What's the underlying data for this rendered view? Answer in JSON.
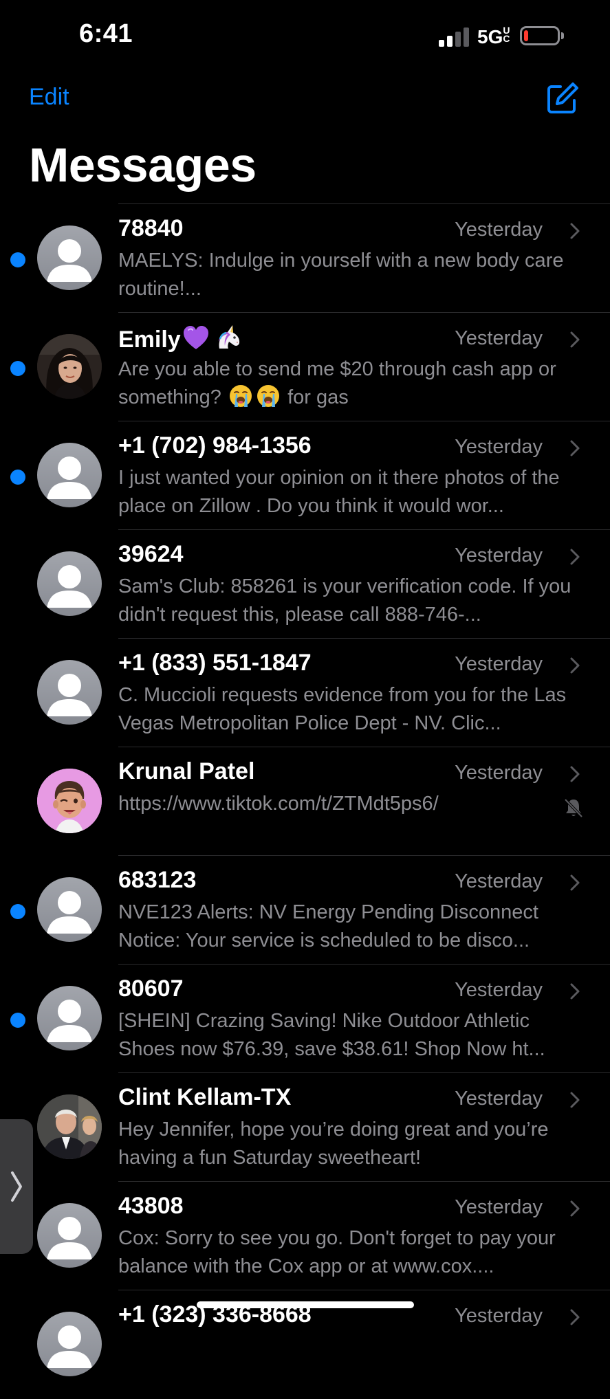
{
  "status_bar": {
    "time": "6:41",
    "network": "5G",
    "network_suffix": "UC",
    "battery_level": 0.1,
    "signal_bars_active": 2,
    "signal_bars_total": 4
  },
  "header": {
    "edit_label": "Edit",
    "compose_icon": "compose-icon",
    "title": "Messages"
  },
  "colors": {
    "accent": "#0a84ff",
    "background": "#000000",
    "secondary_text": "#8e8e93",
    "battery_low": "#ff3b30"
  },
  "conversations": [
    {
      "name": "78840",
      "time": "Yesterday",
      "preview": "MAELYS: Indulge in yourself with a new body care routine!...",
      "unread": true,
      "avatar": "default-avatar"
    },
    {
      "name": "Emily",
      "name_emojis": [
        "purple-heart",
        "unicorn"
      ],
      "time": "Yesterday",
      "preview_part1": "Are you able to send me $20 through cash app or something?",
      "preview_emojis": [
        "loudly-crying-face",
        "loudly-crying-face"
      ],
      "preview_part2": "for gas",
      "unread": true,
      "avatar": "photo-avatar"
    },
    {
      "name": "+1 (702) 984-1356",
      "time": "Yesterday",
      "preview": "I just wanted your opinion on it there photos of the place on Zillow . Do you think it would wor...",
      "unread": true,
      "avatar": "default-avatar"
    },
    {
      "name": "39624",
      "time": "Yesterday",
      "preview": "Sam's Club: 858261 is your verification code. If you didn't request this, please call 888-746-...",
      "unread": false,
      "avatar": "default-avatar"
    },
    {
      "name": "+1 (833) 551-1847",
      "time": "Yesterday",
      "preview": "C. Muccioli requests evidence from you for the Las Vegas Metropolitan Police Dept - NV. Clic...",
      "unread": false,
      "avatar": "default-avatar"
    },
    {
      "name": "Krunal Patel",
      "time": "Yesterday",
      "preview": "https://www.tiktok.com/t/ZTMdt5ps6/",
      "unread": false,
      "muted": true,
      "avatar": "memoji-avatar"
    },
    {
      "name": "683123",
      "time": "Yesterday",
      "preview": "NVE123 Alerts: NV Energy Pending Disconnect Notice: Your service is scheduled to be disco...",
      "unread": true,
      "avatar": "default-avatar"
    },
    {
      "name": "80607",
      "time": "Yesterday",
      "preview": "[SHEIN] Crazing Saving! Nike Outdoor Athletic Shoes now $76.39, save $38.61! Shop Now ht...",
      "unread": true,
      "avatar": "default-avatar"
    },
    {
      "name": "Clint Kellam-TX",
      "time": "Yesterday",
      "preview": "Hey Jennifer, hope you’re doing great and you’re having a fun Saturday sweetheart!",
      "unread": false,
      "avatar": "photo-avatar"
    },
    {
      "name": "43808",
      "time": "Yesterday",
      "preview": "Cox: Sorry to see you go. Don't forget to pay your balance with the Cox app or at www.cox....",
      "unread": false,
      "avatar": "default-avatar"
    },
    {
      "name": "+1 (323) 336-8668",
      "time": "Yesterday",
      "preview": "",
      "unread": false,
      "avatar": "default-avatar"
    }
  ]
}
